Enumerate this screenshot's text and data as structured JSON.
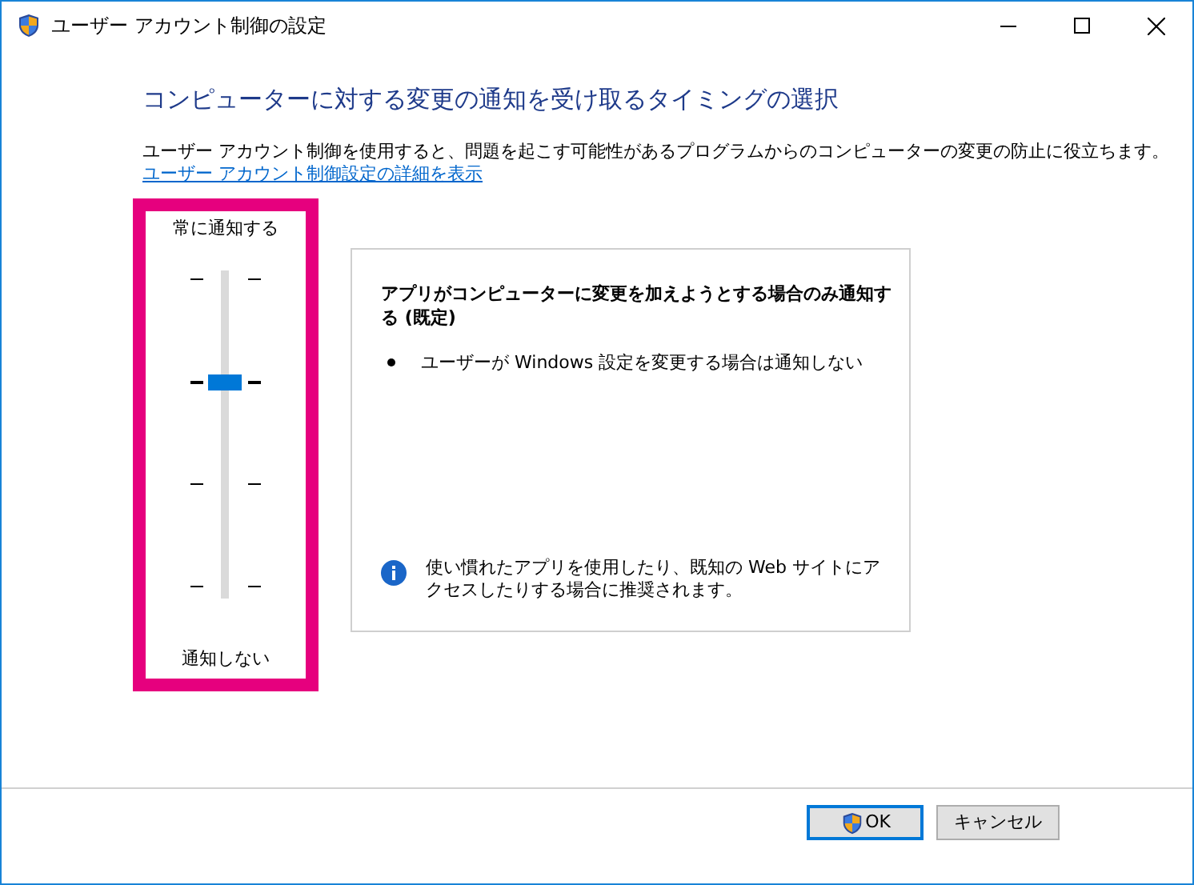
{
  "window": {
    "title": "ユーザー アカウント制御の設定"
  },
  "heading": "コンピューターに対する変更の通知を受け取るタイミングの選択",
  "description": "ユーザー アカウント制御を使用すると、問題を起こす可能性があるプログラムからのコンピューターの変更の防止に役立ちます。",
  "details_link": "ユーザー アカウント制御設定の詳細を表示",
  "slider": {
    "top_label": "常に通知する",
    "bottom_label": "通知しない",
    "level": 0.667
  },
  "panel": {
    "title": "アプリがコンピューターに変更を加えようとする場合のみ通知する (既定)",
    "bullets": [
      "ユーザーが Windows 設定を変更する場合は通知しない"
    ],
    "note": "使い慣れたアプリを使用したり、既知の Web サイトにアクセスしたりする場合に推奨されます。"
  },
  "buttons": [
    {
      "label": "OK",
      "kind": "shield",
      "default": true
    },
    {
      "label": "キャンセル",
      "kind": "plain",
      "default": false
    }
  ]
}
